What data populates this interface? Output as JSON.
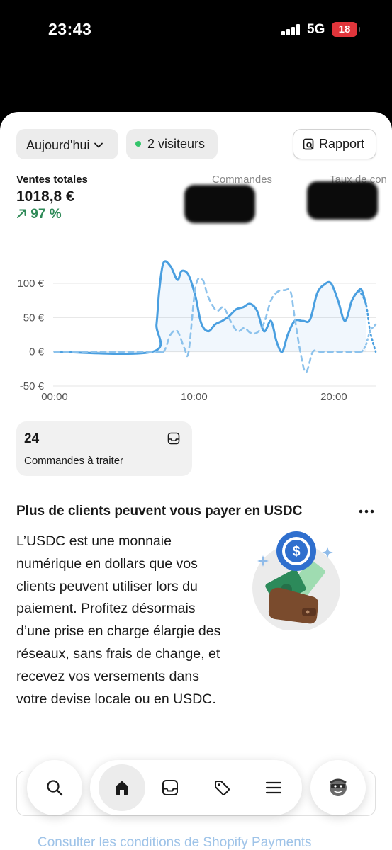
{
  "status_bar": {
    "time": "23:43",
    "network": "5G",
    "battery": "18"
  },
  "header": {
    "date_filter": "Aujourd'hui",
    "visitors": "2 visiteurs",
    "report_button": "Rapport"
  },
  "metrics": {
    "sales_label": "Ventes totales",
    "sales_value": "1018,8 €",
    "sales_change": "97 %",
    "orders_label": "Commandes",
    "conversion_label": "Taux de con"
  },
  "chart_data": {
    "type": "line",
    "x_ticks": [
      "00:00",
      "10:00",
      "20:00"
    ],
    "y_ticks": [
      "100 €",
      "50 €",
      "0 €",
      "-50 €"
    ],
    "ylim": [
      -50,
      130
    ],
    "xlim": [
      0,
      23
    ],
    "grid": true,
    "series": [
      {
        "style": "solid",
        "color": "#4a9fe0",
        "x": [
          0,
          7,
          7.3,
          7.5,
          7.8,
          8.3,
          8.8,
          9.1,
          9.6,
          10.1,
          10.5,
          11,
          11.5,
          12,
          12.5,
          13,
          13.5,
          14,
          14.5,
          15,
          15.5,
          15.9,
          16.3,
          16.7,
          17.2,
          17.8,
          18.3,
          18.8,
          19.3,
          19.8,
          20.3,
          20.8,
          21.3,
          21.8,
          22,
          22.3
        ],
        "y": [
          0,
          0,
          40,
          90,
          130,
          125,
          105,
          118,
          112,
          80,
          42,
          30,
          40,
          45,
          52,
          62,
          65,
          70,
          60,
          30,
          45,
          15,
          0,
          25,
          45,
          45,
          47,
          85,
          98,
          100,
          75,
          45,
          75,
          90,
          90,
          70
        ]
      },
      {
        "style": "dashed",
        "color": "#8cc2ec",
        "x": [
          0,
          7,
          7.8,
          8.3,
          8.8,
          9.3,
          9.6,
          10.1,
          10.6,
          11,
          11.6,
          12.1,
          12.6,
          13.1,
          13.6,
          14,
          14.5,
          15,
          15.5,
          16,
          16.5,
          16.9,
          17.2,
          17.6,
          18,
          18.5,
          19,
          19.5,
          20,
          20.5,
          21,
          21.5,
          22
        ],
        "y": [
          0,
          0,
          0,
          25,
          30,
          5,
          0,
          95,
          105,
          80,
          60,
          65,
          45,
          30,
          35,
          28,
          28,
          42,
          75,
          88,
          90,
          88,
          50,
          0,
          -30,
          0,
          0,
          0,
          0,
          0,
          0,
          0,
          0
        ]
      },
      {
        "style": "dotted",
        "color": "#4a9fe0",
        "x": [
          21.8,
          22.3,
          22.6,
          23
        ],
        "y": [
          90,
          70,
          30,
          0
        ]
      },
      {
        "style": "dotted",
        "color": "#8cc2ec",
        "x": [
          22,
          22.3,
          22.6,
          23
        ],
        "y": [
          0,
          10,
          30,
          40
        ]
      }
    ]
  },
  "orders_card": {
    "count": "24",
    "label": "Commandes à traiter"
  },
  "promo": {
    "title": "Plus de clients peuvent vous payer en USDC",
    "body": "L’USDC est une monnaie numérique en dollars que vos clients peuvent utiliser lors du paiement. Profitez désormais d’une prise en charge élargie des réseaux, sans frais de change, et recevez vos versements dans votre devise locale ou en USDC."
  },
  "footer_link": "Consulter les conditions de Shopify Payments",
  "nav": {
    "items": [
      "search-icon",
      "home-icon",
      "inbox-icon",
      "tag-icon",
      "menu-icon",
      "avatar-icon"
    ]
  },
  "colors": {
    "accent": "#4a9fe0",
    "accent_light": "#8cc2ec",
    "positive": "#2f8a58",
    "online_dot": "#33c46a"
  }
}
